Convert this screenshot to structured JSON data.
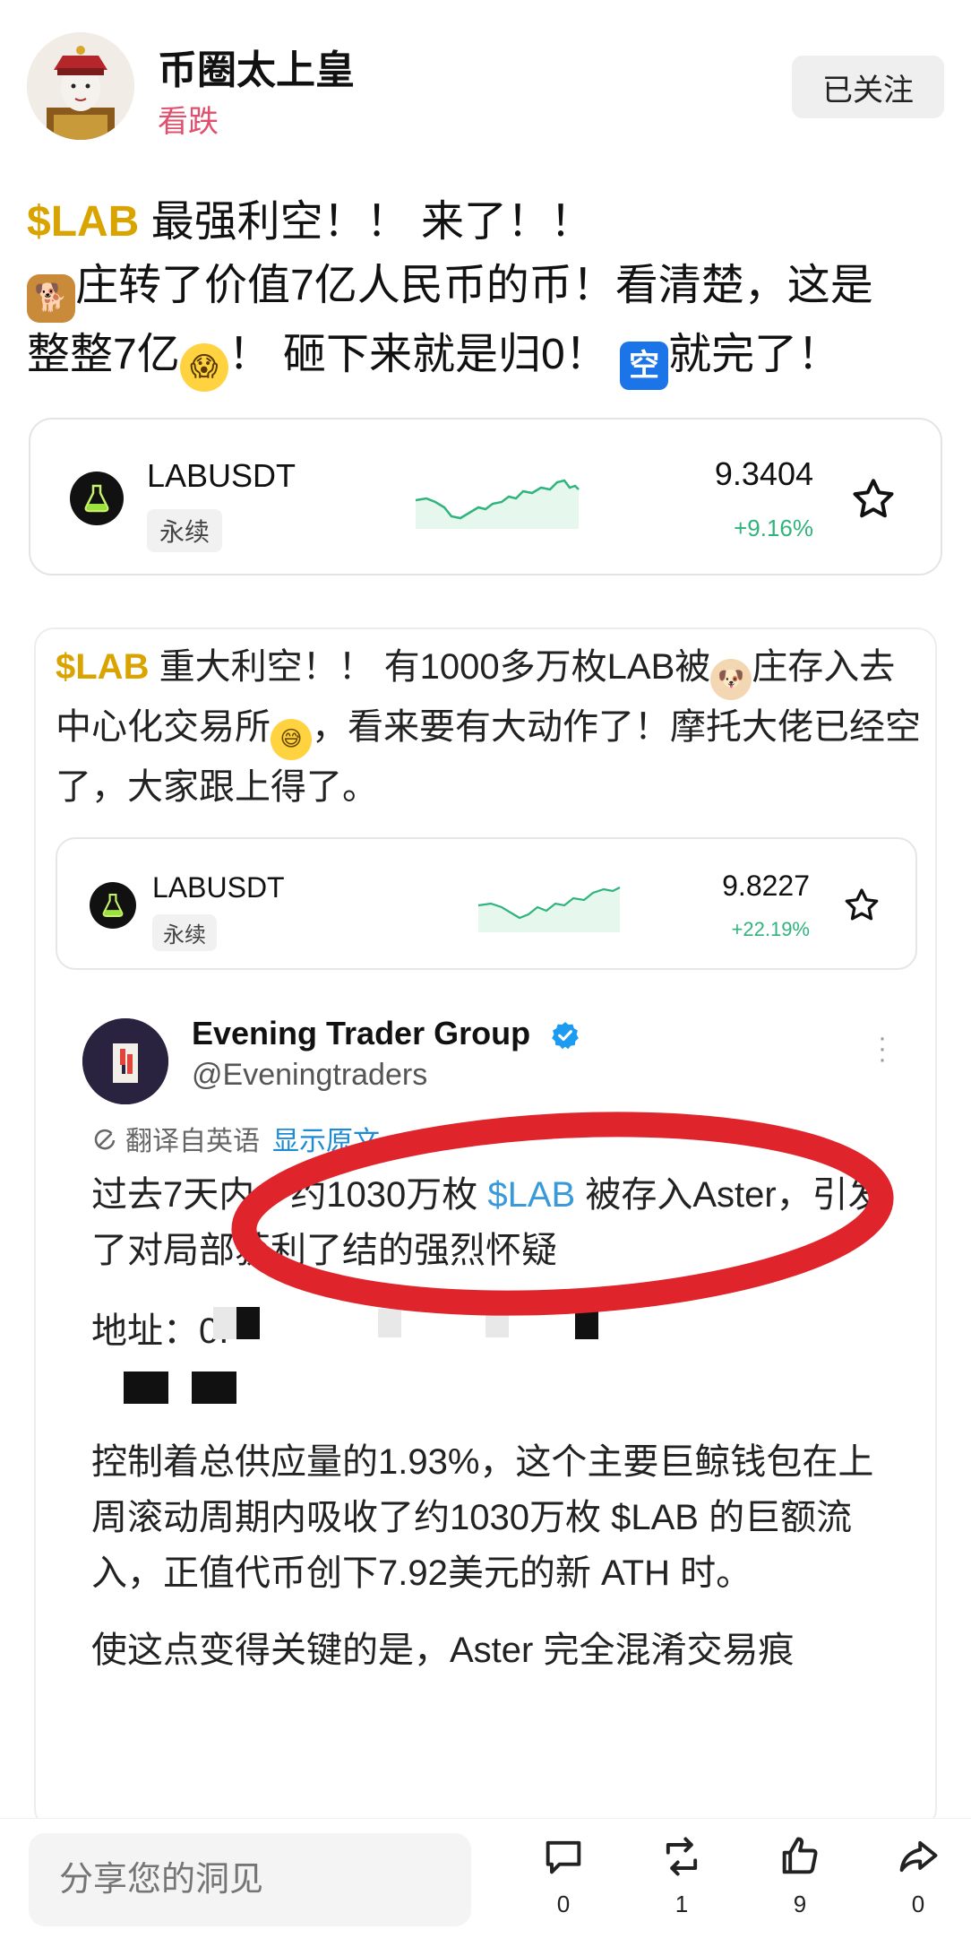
{
  "author": {
    "name": "币圈太上皇",
    "sentiment": "看跌",
    "follow_label": "已关注"
  },
  "post": {
    "tag": "$LAB",
    "line1_rest": " 最强利空！！ 来了！！",
    "line2": "庄转了价值7亿人民币的币！看清楚，这是",
    "line3_a": "整整7亿",
    "line3_b": "！ 砸下来就是归0！ ",
    "line3_c": "就完了！",
    "emoji_kong": "空"
  },
  "ticker_main": {
    "symbol": "LABUSDT",
    "type": "永续",
    "price": "9.3404",
    "change": "+9.16%",
    "change_color": "#2fb47c"
  },
  "quote": {
    "tag": "$LAB",
    "text_a": " 重大利空！！ 有1000多万枚LAB被",
    "text_b": "庄存入去中心化交易所",
    "text_c": "，看来要有大动作了！摩托大佬已经空了，大家跟上得了。",
    "ticker": {
      "symbol": "LABUSDT",
      "type": "永续",
      "price": "9.8227",
      "change": "+22.19%"
    },
    "tweet": {
      "name": "Evening Trader Group",
      "handle": "@Eveningtraders",
      "translate_label": "翻译自英语",
      "show_original": "显示原文",
      "p1_a": "过去7天内，约1030万枚 ",
      "p1_cash": "$LAB",
      "p1_b": " 被存入Aster，引发了对局部获利了结的强烈怀疑",
      "addr_label": "地址：0.",
      "p2_a": "控制着总供应量的1.93%，这个主要巨鲸钱包在上周滚动周期内吸收了约1030万枚 ",
      "p2_cash": "$LAB",
      "p2_b": " 的巨额流入，正值代币创下7.92美元的新 ATH 时。",
      "p3": "使这点变得关键的是，Aster 完全混淆交易痕"
    }
  },
  "bottom": {
    "input_placeholder": "分享您的洞见",
    "comments": "0",
    "reposts": "1",
    "likes": "9",
    "shares": "0"
  },
  "colors": {
    "tag": "#d9a400",
    "positive": "#2fb47c",
    "sentiment": "#e0506e",
    "highlight_circle": "#e0242b"
  },
  "icons": [
    "star-icon",
    "comment-icon",
    "repost-icon",
    "like-icon",
    "share-icon",
    "verified-icon",
    "translate-icon",
    "more-icon"
  ]
}
